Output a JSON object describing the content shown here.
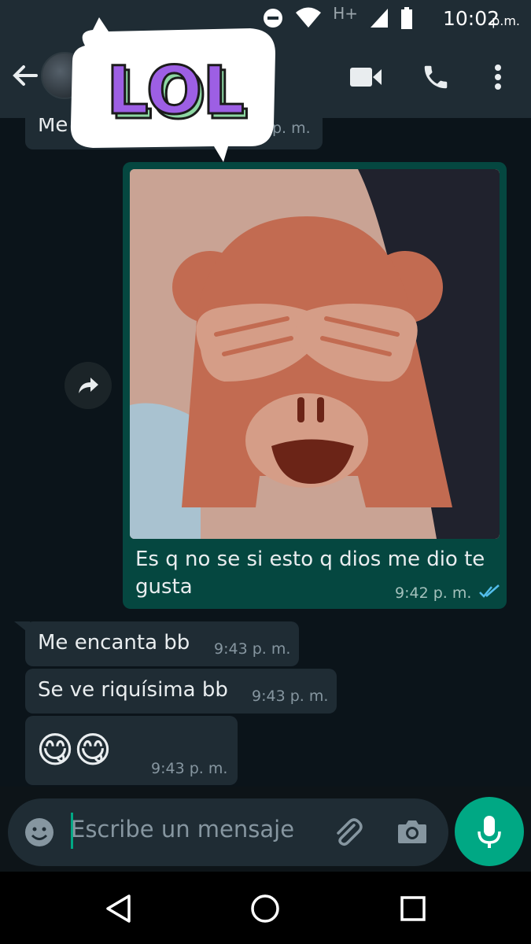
{
  "status_bar": {
    "time": "10:02",
    "ampm": "p.m.",
    "network_label": "H+",
    "icons": [
      "dnd-icon",
      "wifi-icon",
      "signal-icon",
      "battery-icon"
    ]
  },
  "header": {
    "icons": [
      "back-arrow-icon",
      "video-call-icon",
      "phone-icon",
      "more-vert-icon"
    ]
  },
  "sticker": {
    "text": "LOL"
  },
  "messages": [
    {
      "direction": "in",
      "text": "Me",
      "time": "p. m."
    },
    {
      "direction": "out",
      "type": "image",
      "text": "Es q no se si esto q dios me dio te gusta",
      "line1": "Es q no se si esto q dios me dio te",
      "line2": "gusta",
      "time": "9:42 p. m.",
      "status": "read"
    },
    {
      "direction": "in",
      "text": "Me encanta bb",
      "time": "9:43 p. m."
    },
    {
      "direction": "in",
      "text": "Se ve riquísima bb",
      "time": "9:43 p. m."
    },
    {
      "direction": "in",
      "text": "😋😋",
      "time": "9:43 p. m."
    }
  ],
  "composer": {
    "placeholder": "Escribe un mensaje",
    "icons": [
      "emoji-icon",
      "attach-icon",
      "camera-icon",
      "mic-icon"
    ]
  },
  "colors": {
    "accent": "#00a884",
    "outgoing_bubble": "#054740",
    "incoming_bubble": "#1f2c34",
    "read_ticks": "#53bdeb"
  }
}
